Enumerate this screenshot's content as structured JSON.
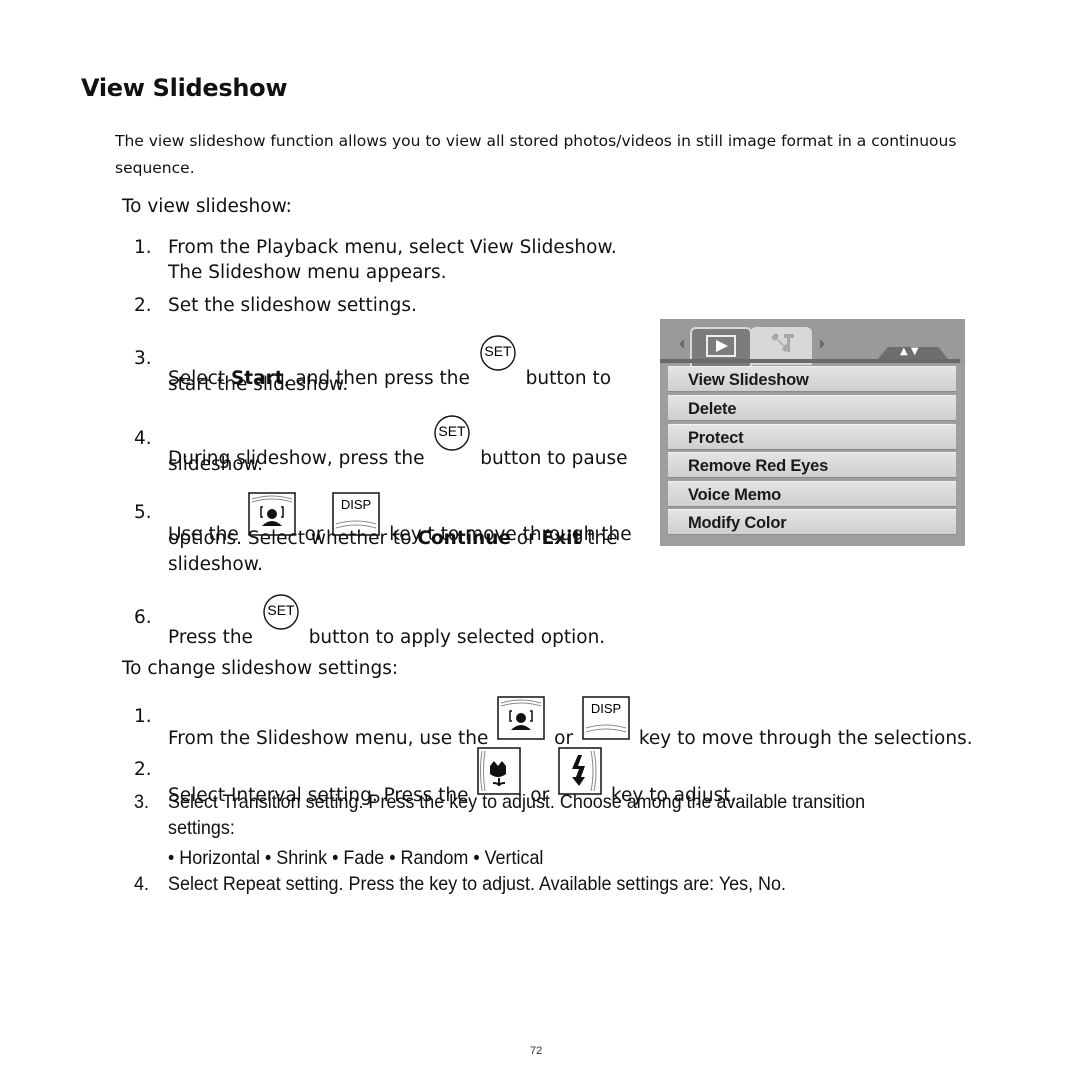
{
  "page": {
    "title": "View Slideshow",
    "intro": "The view slideshow function allows you to view all stored photos/videos in still image format in a continuous sequence.",
    "page_number": "72"
  },
  "view_section": {
    "heading": "To view slideshow:",
    "steps": [
      {
        "num": "1.",
        "line1": "From the Playback menu, select View Slideshow.",
        "line2": "The Slideshow menu appears."
      },
      {
        "num": "2.",
        "line1": "Set the slideshow settings."
      },
      {
        "num": "3.",
        "pre": "Select ",
        "bold": "Start",
        "mid": ", and then press the",
        "post": "button to",
        "line2": "start the slideshow."
      },
      {
        "num": "4.",
        "pre": "During slideshow, press the",
        "post": "button to pause",
        "line2": "slideshow."
      },
      {
        "num": "5.",
        "pre": "Use the",
        "or": "or",
        "post": "key t to move through the",
        "l2_pre": "options. Select whether to ",
        "l2_bold1": "Continue",
        "l2_mid": " or ",
        "l2_bold2": "Exit",
        "l2_post": " the",
        "line3": "slideshow."
      },
      {
        "num": "6.",
        "pre": "Press the",
        "post": "button to apply selected option."
      }
    ]
  },
  "change_section": {
    "heading": "To change slideshow settings:",
    "steps": [
      {
        "num": "1.",
        "pre": "From the Slideshow menu, use the",
        "or": "or",
        "post": "key to move through the selections."
      },
      {
        "num": "2.",
        "pre": "Select Interval setting. Press the",
        "or": "or",
        "post": "key to adjust."
      },
      {
        "num": "3.",
        "line1": "Select Transition setting. Press the key to adjust. Choose among the available transition",
        "line2": "settings:",
        "options": "• Horizontal • Shrink • Fade • Random • Vertical"
      },
      {
        "num": "4.",
        "line1": "Select Repeat setting. Press the key to adjust. Available settings are: Yes, No."
      }
    ]
  },
  "icons": {
    "set_button": "SET",
    "disp_button": "DISP"
  },
  "camera_menu": {
    "tabs": [
      "playback-icon",
      "settings-wrench-icon"
    ],
    "scroll_indicator": "▲ ▼",
    "items": [
      "View Slideshow",
      "Delete",
      "Protect",
      "Remove Red Eyes",
      "Voice Memo",
      "Modify Color"
    ]
  }
}
